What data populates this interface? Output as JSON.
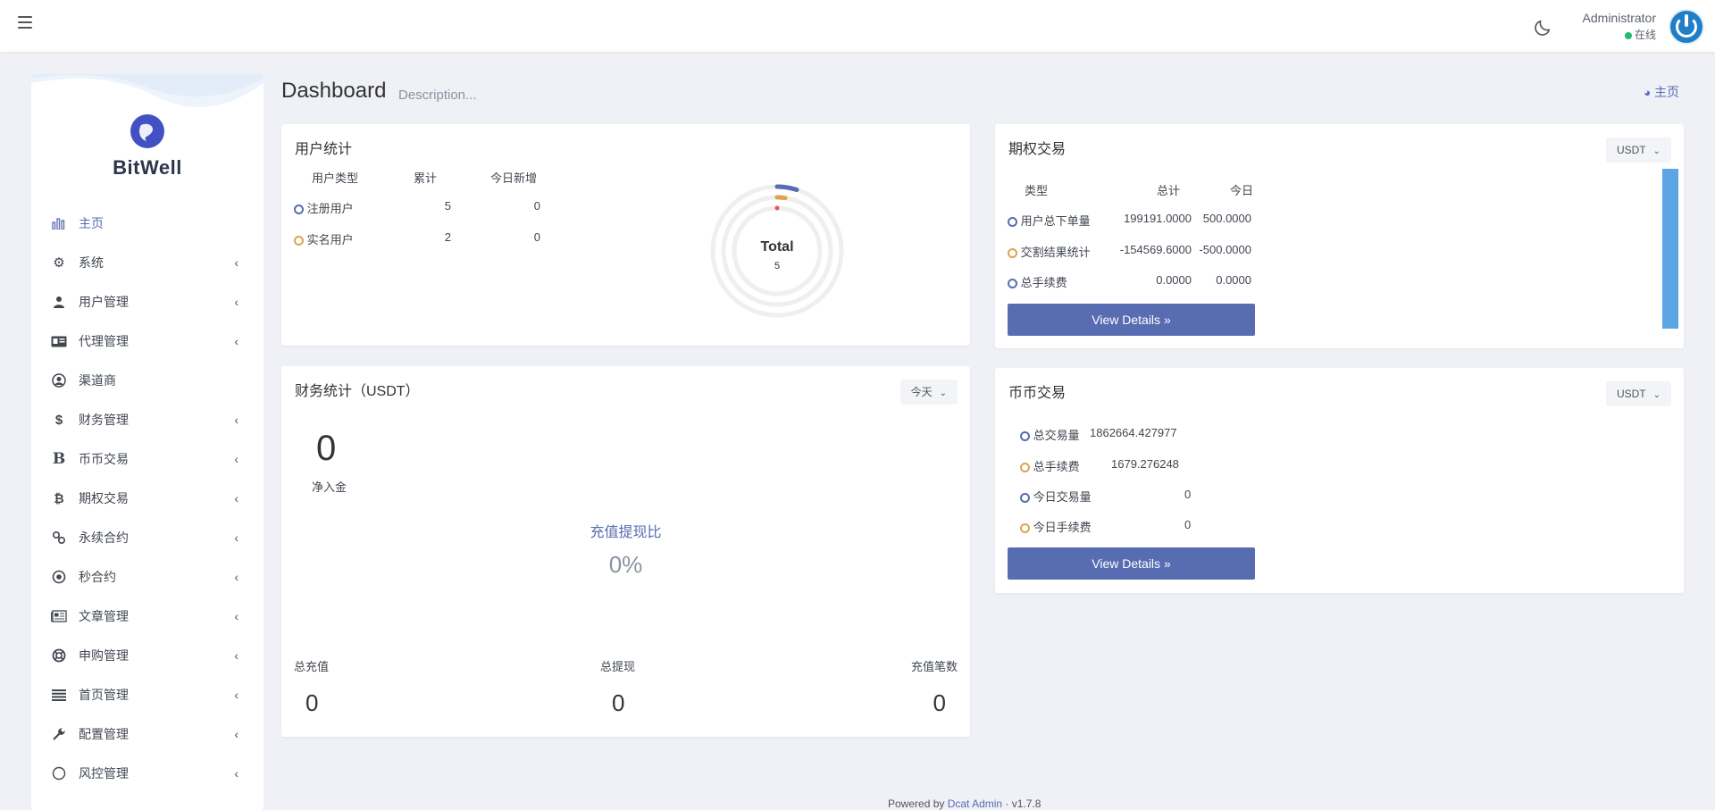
{
  "navbar": {
    "user_name": "Administrator",
    "user_status": "在线"
  },
  "brand": {
    "name": "BitWell"
  },
  "sidebar": {
    "items": [
      {
        "label": "主页",
        "icon": "bar-chart-icon"
      },
      {
        "label": "系统",
        "icon": "gear-icon"
      },
      {
        "label": "用户管理",
        "icon": "users-icon"
      },
      {
        "label": "代理管理",
        "icon": "id-card-icon"
      },
      {
        "label": "渠道商",
        "icon": "user-circle-icon"
      },
      {
        "label": "财务管理",
        "icon": "dollar-icon"
      },
      {
        "label": "币币交易",
        "icon": "bitcoin-b-icon"
      },
      {
        "label": "期权交易",
        "icon": "bitcoin-icon"
      },
      {
        "label": "永续合约",
        "icon": "link-icon"
      },
      {
        "label": "秒合约",
        "icon": "dot-circle-icon"
      },
      {
        "label": "文章管理",
        "icon": "newspaper-icon"
      },
      {
        "label": "申购管理",
        "icon": "life-ring-icon"
      },
      {
        "label": "首页管理",
        "icon": "list-icon"
      },
      {
        "label": "配置管理",
        "icon": "wrench-icon"
      },
      {
        "label": "风控管理",
        "icon": "circle-icon"
      }
    ]
  },
  "header": {
    "title": "Dashboard",
    "description": "Description...",
    "breadcrumb": "主页"
  },
  "user_stats": {
    "title": "用户统计",
    "columns": [
      "用户类型",
      "累计",
      "今日新增"
    ],
    "rows": [
      {
        "type": "注册用户",
        "total": "5",
        "today": "0"
      },
      {
        "type": "实名用户",
        "total": "2",
        "today": "0"
      }
    ],
    "donut_label": "Total",
    "donut_value": "5"
  },
  "options_trade": {
    "title": "期权交易",
    "currency": "USDT",
    "columns": [
      "类型",
      "总计",
      "今日"
    ],
    "rows": [
      {
        "type": "用户总下单量",
        "total": "199191.0000",
        "today": "500.0000"
      },
      {
        "type": "交割结果统计",
        "total": "-154569.6000",
        "today": "-500.0000"
      },
      {
        "type": "总手续费",
        "total": "0.0000",
        "today": "0.0000"
      }
    ],
    "button": "View Details"
  },
  "finance": {
    "title": "财务统计（USDT）",
    "period": "今天",
    "net_value": "0",
    "net_label": "净入金",
    "ratio_label": "充值提现比",
    "ratio_value": "0%",
    "totals": [
      {
        "label": "总充值",
        "value": "0"
      },
      {
        "label": "总提现",
        "value": "0"
      },
      {
        "label": "充值笔数",
        "value": "0"
      }
    ]
  },
  "coin_trade": {
    "title": "币币交易",
    "currency": "USDT",
    "rows": [
      {
        "label": "总交易量",
        "value": "1862664.427977"
      },
      {
        "label": "总手续费",
        "value": "1679.276248"
      },
      {
        "label": "今日交易量",
        "value": "0"
      },
      {
        "label": "今日手续费",
        "value": "0"
      }
    ],
    "button": "View Details"
  },
  "footer": {
    "powered": "Powered by",
    "brand": "Dcat Admin",
    "version": "· v1.7.8"
  },
  "colors": {
    "primary": "#586cb1",
    "orange": "#dda451",
    "red": "#ea5455",
    "blue_bar": "#5ca5e4"
  }
}
